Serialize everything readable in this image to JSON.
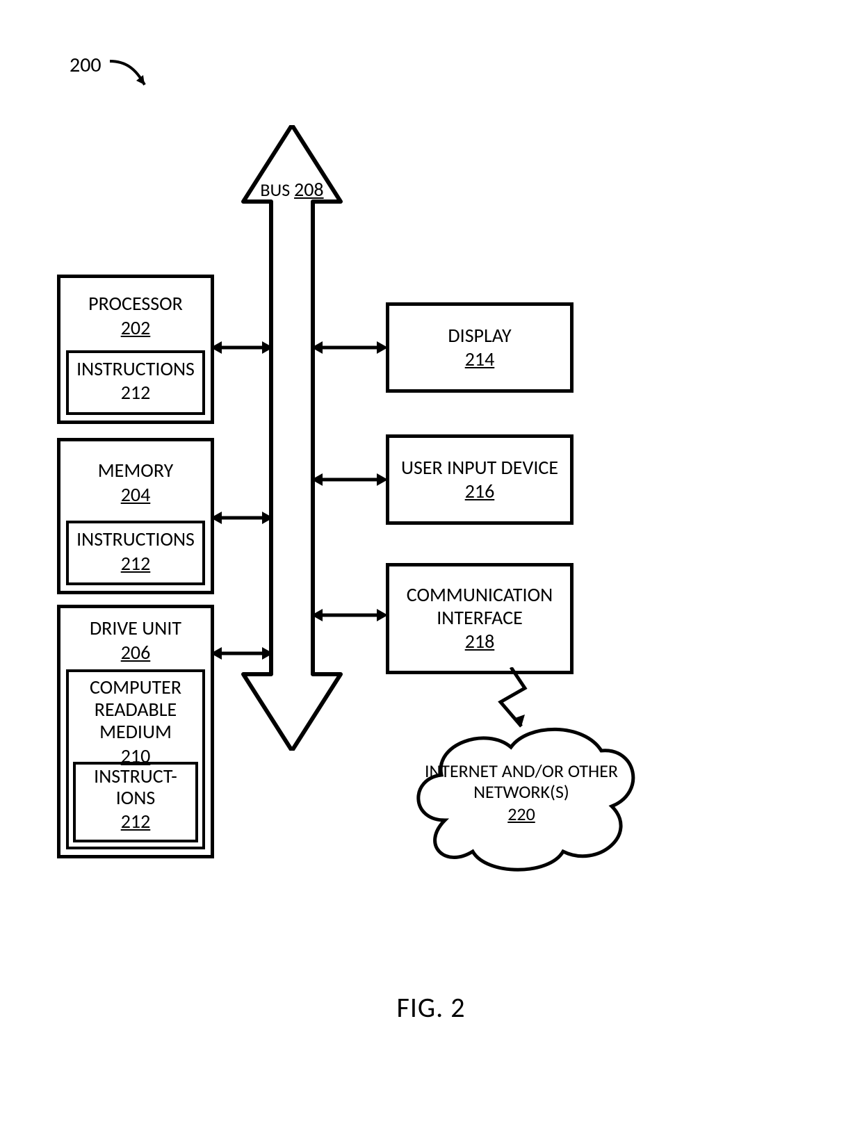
{
  "figure": {
    "number_label": "200",
    "caption": "FIG. 2"
  },
  "bus": {
    "label": "BUS",
    "ref": "208"
  },
  "left": {
    "processor": {
      "label": "PROCESSOR",
      "ref": "202",
      "inner": {
        "label": "INSTRUCTIONS",
        "ref": "212"
      }
    },
    "memory": {
      "label": "MEMORY",
      "ref": "204",
      "inner": {
        "label": "INSTRUCTIONS",
        "ref": "212"
      }
    },
    "drive": {
      "label": "DRIVE UNIT",
      "ref": "206",
      "medium": {
        "label": "COMPUTER READABLE MEDIUM",
        "ref": "210",
        "inner": {
          "label_line1": "INSTRUCT-",
          "label_line2": "IONS",
          "ref": "212"
        }
      }
    }
  },
  "right": {
    "display": {
      "label": "DISPLAY",
      "ref": "214"
    },
    "input": {
      "label": "USER INPUT DEVICE",
      "ref": "216"
    },
    "comm": {
      "label": "COMMUNICATION INTERFACE",
      "ref": "218"
    },
    "network": {
      "label": "INTERNET AND/OR OTHER NETWORK(S)",
      "ref": "220"
    }
  }
}
